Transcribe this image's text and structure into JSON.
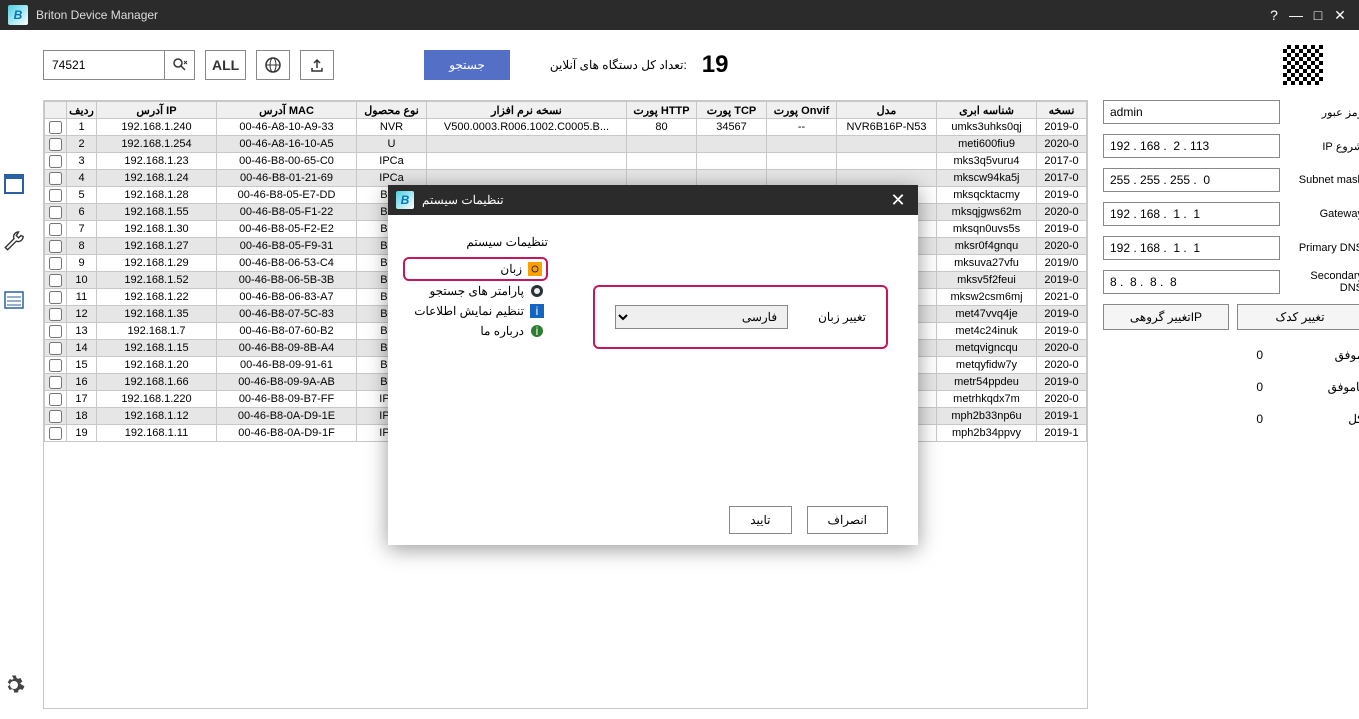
{
  "app_title": "Briton Device Manager",
  "search_value": "74521",
  "toolbar": {
    "all": "ALL",
    "search_btn": "جستجو"
  },
  "online": {
    "label": ":تعداد کل دستگاه های آنلاین",
    "count": "19"
  },
  "columns": {
    "row": "ردیف",
    "ip": "آدرس IP",
    "mac": "آدرس MAC",
    "ptype": "نوع محصول",
    "fw": "نسخه نرم افزار",
    "http": "پورت HTTP",
    "tcp": "پورت TCP",
    "onvif": "پورت Onvif",
    "model": "مدل",
    "cloud": "شناسه ابری",
    "ver": "نسخه"
  },
  "rows": [
    {
      "n": "1",
      "ip": "192.168.1.240",
      "mac": "00-46-A8-10-A9-33",
      "pt": "NVR",
      "fw": "V500.0003.R006.1002.C0005.B...",
      "http": "80",
      "tcp": "34567",
      "onvif": "--",
      "model": "NVR6B16P-N53",
      "cloud": "umks3uhks0qj",
      "v": "2019-0"
    },
    {
      "n": "2",
      "ip": "192.168.1.254",
      "mac": "00-46-A8-16-10-A5",
      "pt": "U",
      "fw": "",
      "http": "",
      "tcp": "",
      "onvif": "",
      "model": "",
      "cloud": "meti600fiu9",
      "v": "2020-0"
    },
    {
      "n": "3",
      "ip": "192.168.1.23",
      "mac": "00-46-B8-00-65-C0",
      "pt": "IPCa",
      "fw": "",
      "http": "",
      "tcp": "",
      "onvif": "",
      "model": "",
      "cloud": "mks3q5vuru4",
      "v": "2017-0"
    },
    {
      "n": "4",
      "ip": "192.168.1.24",
      "mac": "00-46-B8-01-21-69",
      "pt": "IPCa",
      "fw": "",
      "http": "",
      "tcp": "",
      "onvif": "",
      "model": "",
      "cloud": "mkscw94ka5j",
      "v": "2017-0"
    },
    {
      "n": "5",
      "ip": "192.168.1.28",
      "mac": "00-46-B8-05-E7-DD",
      "pt": "Brito",
      "fw": "",
      "http": "",
      "tcp": "",
      "onvif": "",
      "model": "",
      "cloud": "mksqcktacmy",
      "v": "2019-0"
    },
    {
      "n": "6",
      "ip": "192.168.1.55",
      "mac": "00-46-B8-05-F1-22",
      "pt": "Brito",
      "fw": "",
      "http": "",
      "tcp": "",
      "onvif": "",
      "model": "",
      "cloud": "mksqjgws62m",
      "v": "2020-0"
    },
    {
      "n": "7",
      "ip": "192.168.1.30",
      "mac": "00-46-B8-05-F2-E2",
      "pt": "Brito",
      "fw": "",
      "http": "",
      "tcp": "",
      "onvif": "",
      "model": "",
      "cloud": "mksqn0uvs5s",
      "v": "2019-0"
    },
    {
      "n": "8",
      "ip": "192.168.1.27",
      "mac": "00-46-B8-05-F9-31",
      "pt": "Brito",
      "fw": "",
      "http": "",
      "tcp": "",
      "onvif": "",
      "model": "",
      "cloud": "mksr0f4gnqu",
      "v": "2020-0"
    },
    {
      "n": "9",
      "ip": "192.168.1.29",
      "mac": "00-46-B8-06-53-C4",
      "pt": "Brito",
      "fw": "",
      "http": "",
      "tcp": "",
      "onvif": "",
      "model": "",
      "cloud": "mksuva27vfu",
      "v": "2019/0"
    },
    {
      "n": "10",
      "ip": "192.168.1.52",
      "mac": "00-46-B8-06-5B-3B",
      "pt": "Brito",
      "fw": "",
      "http": "",
      "tcp": "",
      "onvif": "",
      "model": "",
      "cloud": "mksv5f2feui",
      "v": "2019-0"
    },
    {
      "n": "11",
      "ip": "192.168.1.22",
      "mac": "00-46-B8-06-83-A7",
      "pt": "Brito",
      "fw": "",
      "http": "",
      "tcp": "",
      "onvif": "",
      "model": "",
      "cloud": "mksw2csm6mj",
      "v": "2021-0"
    },
    {
      "n": "12",
      "ip": "192.168.1.35",
      "mac": "00-46-B8-07-5C-83",
      "pt": "Brito",
      "fw": "",
      "http": "",
      "tcp": "",
      "onvif": "",
      "model": "",
      "cloud": "met47vvq4je",
      "v": "2019-0"
    },
    {
      "n": "13",
      "ip": "192.168.1.7",
      "mac": "00-46-B8-07-60-B2",
      "pt": "Brito",
      "fw": "",
      "http": "",
      "tcp": "",
      "onvif": "",
      "model": "",
      "cloud": "met4c24inuk",
      "v": "2019-0"
    },
    {
      "n": "14",
      "ip": "192.168.1.15",
      "mac": "00-46-B8-09-8B-A4",
      "pt": "Brito",
      "fw": "",
      "http": "",
      "tcp": "",
      "onvif": "",
      "model": "",
      "cloud": "metqvigncqu",
      "v": "2020-0"
    },
    {
      "n": "15",
      "ip": "192.168.1.20",
      "mac": "00-46-B8-09-91-61",
      "pt": "Brito",
      "fw": "",
      "http": "",
      "tcp": "",
      "onvif": "",
      "model": "",
      "cloud": "metqyfidw7y",
      "v": "2020-0"
    },
    {
      "n": "16",
      "ip": "192.168.1.66",
      "mac": "00-46-B8-09-9A-AB",
      "pt": "Brito",
      "fw": "",
      "http": "",
      "tcp": "",
      "onvif": "",
      "model": "",
      "cloud": "metr54ppdeu",
      "v": "2019-0"
    },
    {
      "n": "17",
      "ip": "192.168.1.220",
      "mac": "00-46-B8-09-B7-FF",
      "pt": "IPCa",
      "fw": "",
      "http": "",
      "tcp": "",
      "onvif": "",
      "model": "",
      "cloud": "metrhkqdx7m",
      "v": "2020-0"
    },
    {
      "n": "18",
      "ip": "192.168.1.12",
      "mac": "00-46-B8-0A-D9-1E",
      "pt": "IPCa",
      "fw": "",
      "http": "",
      "tcp": "",
      "onvif": "",
      "model": "",
      "cloud": "mph2b33np6u",
      "v": "2019-1"
    },
    {
      "n": "19",
      "ip": "192.168.1.11",
      "mac": "00-46-B8-0A-D9-1F",
      "pt": "IPCa",
      "fw": "",
      "http": "",
      "tcp": "",
      "onvif": "",
      "model": "",
      "cloud": "mph2b34ppvy",
      "v": "2019-1"
    }
  ],
  "right": {
    "pass_label": "رمز عبور",
    "pass_value": "admin",
    "startip_label": "شروع IP",
    "startip_value": "192 . 168 .  2 . 113",
    "subnet_label": "Subnet mask",
    "subnet_value": "255 . 255 . 255 .  0",
    "gateway_label": "Gateway",
    "gateway_value": "192 . 168 .  1 .  1",
    "pdns_label": "Primary DNS",
    "pdns_value": "192 . 168 .  1 .  1",
    "sdns_label": "Secondary DNS",
    "sdns_value": "8 .  8 .  8 .  8",
    "btn_group_ip": "تغییر گروهیIP",
    "btn_codec": "تغییر کدک",
    "ok_label": "موفق",
    "ok_val": "0",
    "fail_label": "ناموفق",
    "fail_val": "0",
    "total_label": "کل",
    "total_val": "0"
  },
  "modal": {
    "title": "تنظیمات سیستم",
    "side_title": "تنظیمات سیستم",
    "items": {
      "lang": "زبان",
      "params": "پارامتر های جستجو",
      "display": "تنظیم نمایش اطلاعات",
      "about": "درباره ما"
    },
    "field_label": "تغییر زبان",
    "field_value": "فارسی",
    "ok": "تایید",
    "cancel": "انصراف"
  }
}
